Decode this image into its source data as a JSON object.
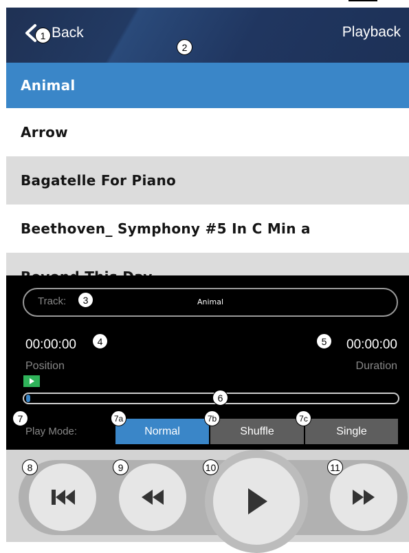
{
  "header": {
    "back_label": "Back",
    "title": "Playback"
  },
  "tracks": [
    {
      "name": "Animal",
      "selected": true
    },
    {
      "name": "Arrow"
    },
    {
      "name": "Bagatelle For Piano"
    },
    {
      "name": "Beethoven_ Symphony #5 In C Min a"
    },
    {
      "name": "Beyond This Day"
    }
  ],
  "player": {
    "track_label": "Track:",
    "track_name": "Animal",
    "position_time": "00:00:00",
    "position_label": "Position",
    "duration_time": "00:00:00",
    "duration_label": "Duration",
    "progress_fraction": 0.0,
    "play_mode_label": "Play Mode:",
    "modes": [
      "Normal",
      "Shuffle",
      "Single"
    ],
    "selected_mode": "Normal"
  },
  "controls": [
    "skip-back",
    "rewind",
    "play",
    "fast-forward"
  ],
  "callouts": [
    "1",
    "2",
    "3",
    "4",
    "5",
    "6",
    "7",
    "7a",
    "7b",
    "7c",
    "8",
    "9",
    "10",
    "11"
  ],
  "colors": {
    "accent": "#3a86c8",
    "header": "#1f3154",
    "play_badge": "#2fb35a",
    "mode_inactive": "#5e5e5e"
  }
}
